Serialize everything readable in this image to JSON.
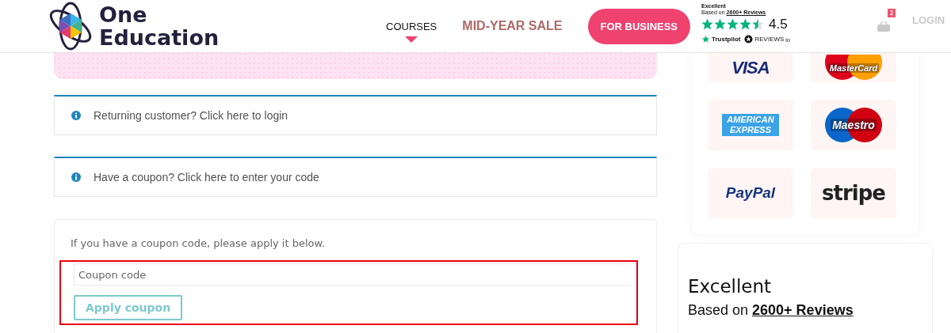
{
  "header": {
    "logo_lines": [
      "One",
      "Education"
    ],
    "nav": [
      {
        "label": "COURSES",
        "selected": true,
        "kind": "link"
      },
      {
        "label": "MID-YEAR SALE",
        "selected": false,
        "kind": "sale"
      },
      {
        "label": "FOR BUSINESS",
        "selected": false,
        "kind": "pill"
      }
    ],
    "trustpilot": {
      "heading": "Excellent",
      "based_on": "Based on",
      "reviews_link": "2600+ Reviews",
      "stars": 4.5,
      "score": "4.5",
      "brand": "Trustpilot",
      "reviews_brand": "REVIEWS",
      "reviews_suffix": "io"
    },
    "cart_count": "2",
    "login": "LOGIN"
  },
  "notices": [
    {
      "text": "Returning customer? Click here to login"
    },
    {
      "text": "Have a coupon? Click here to enter your code"
    }
  ],
  "coupon": {
    "hint": "If you have a coupon code, please apply it below.",
    "placeholder": "Coupon code",
    "button": "Apply coupon",
    "highlighted": true
  },
  "payment_methods": [
    {
      "label": "VISA",
      "kind": "visa"
    },
    {
      "label": "MasterCard",
      "kind": "mastercard"
    },
    {
      "label": "AMERICAN EXPRESS",
      "kind": "amex"
    },
    {
      "label": "Maestro",
      "kind": "maestro"
    },
    {
      "label": "PayPal",
      "kind": "paypal"
    },
    {
      "label": "stripe",
      "kind": "stripe"
    }
  ],
  "rating_card": {
    "heading": "Excellent",
    "based_on": "Based on",
    "reviews_link": "2600+ Reviews"
  }
}
